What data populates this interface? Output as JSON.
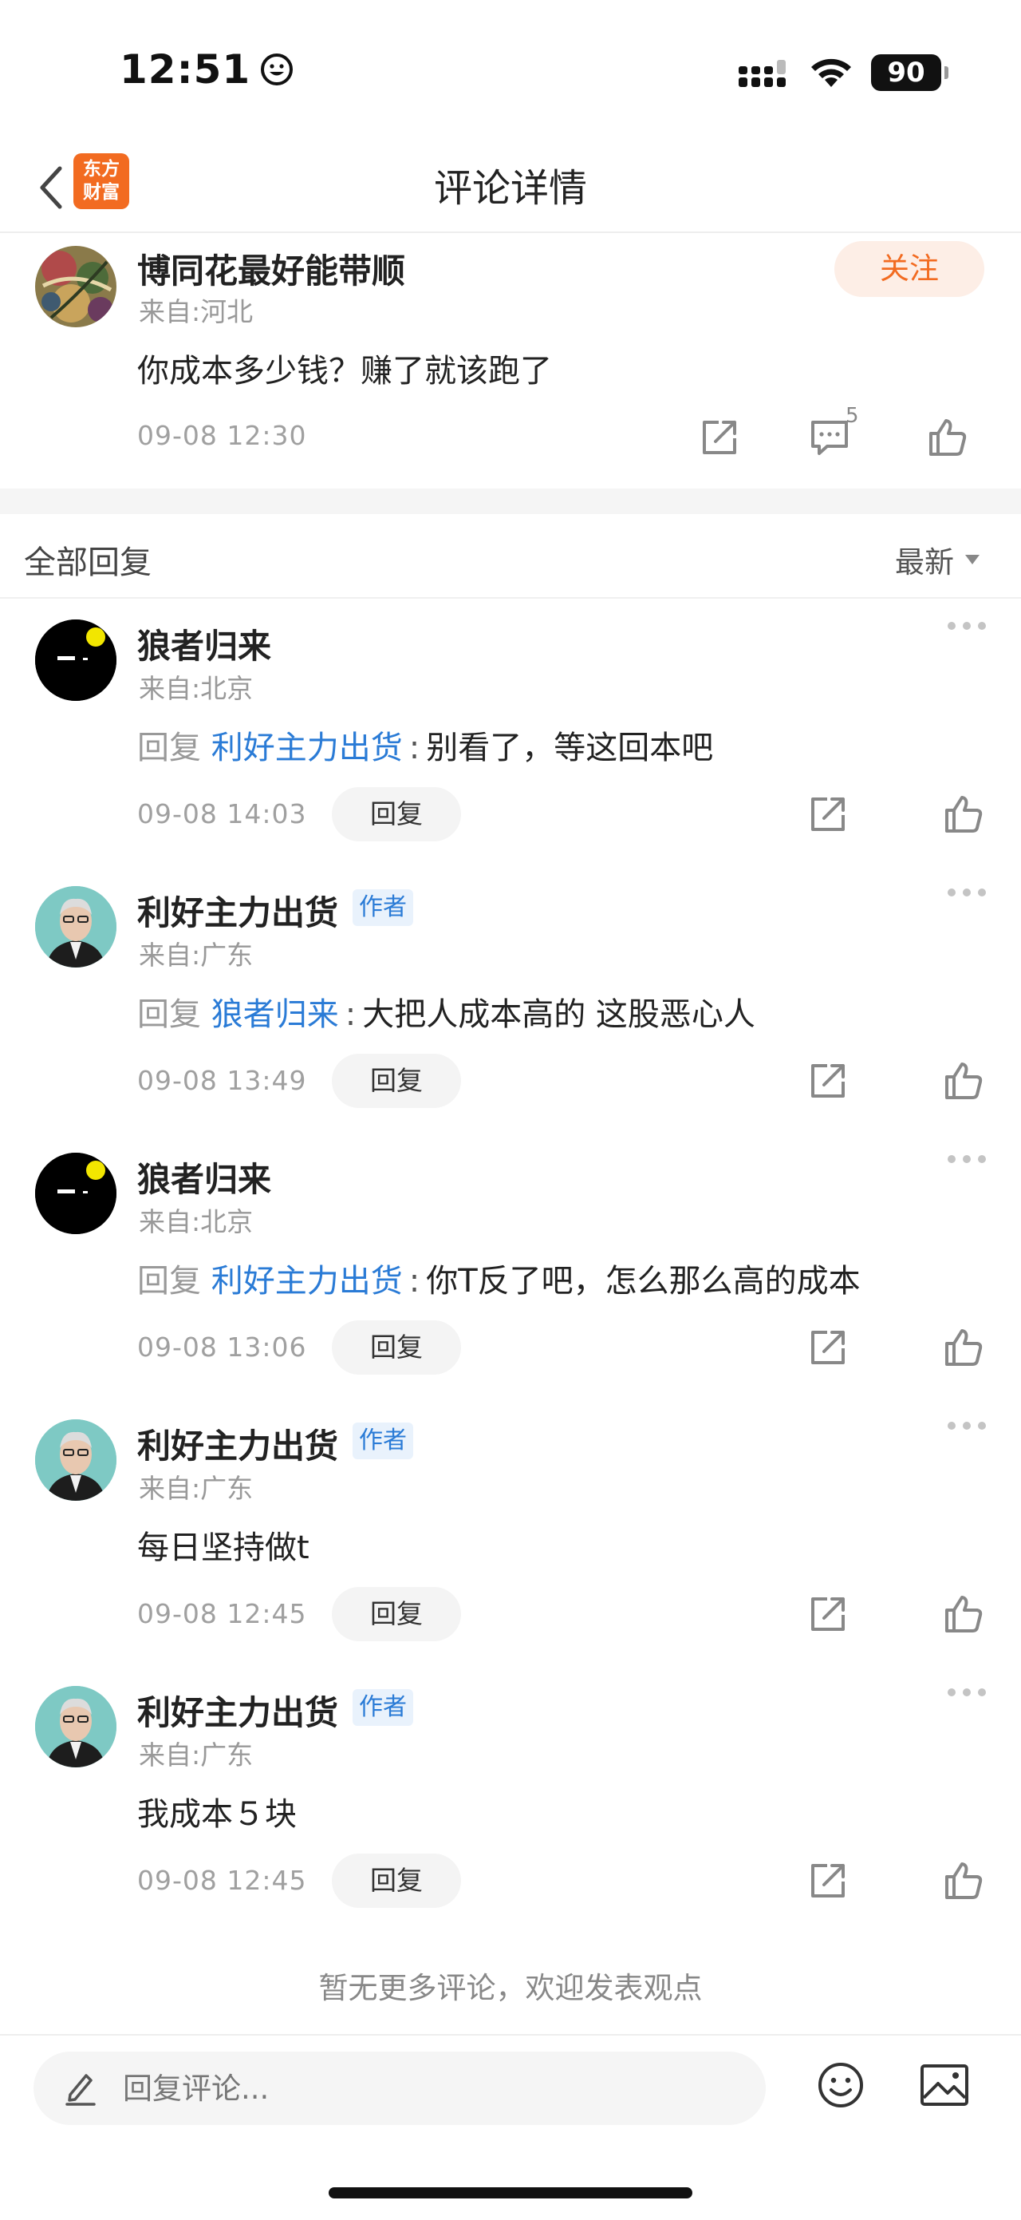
{
  "status_bar": {
    "time": "12:51",
    "battery": "90"
  },
  "nav": {
    "logo_line1": "东方",
    "logo_line2": "财富",
    "title": "评论详情"
  },
  "main_comment": {
    "username": "博同花最好能带顺",
    "location": "来自:河北",
    "text": "你成本多少钱？赚了就该跑了",
    "timestamp": "09-08 12:30",
    "follow_label": "关注",
    "comment_count": "5"
  },
  "replies_header": {
    "title": "全部回复",
    "sort": "最新"
  },
  "replies": [
    {
      "username": "狼者归来",
      "is_author": false,
      "location": "来自:北京",
      "reply_prefix": "回复",
      "reply_target": "利好主力出货",
      "colon": ":",
      "text": "别看了，等这回本吧",
      "timestamp": "09-08 14:03",
      "reply_label": "回复"
    },
    {
      "username": "利好主力出货",
      "is_author": true,
      "author_tag": "作者",
      "location": "来自:广东",
      "reply_prefix": "回复",
      "reply_target": "狼者归来",
      "colon": ":",
      "text": "大把人成本高的 这股恶心人",
      "timestamp": "09-08 13:49",
      "reply_label": "回复"
    },
    {
      "username": "狼者归来",
      "is_author": false,
      "location": "来自:北京",
      "reply_prefix": "回复",
      "reply_target": "利好主力出货",
      "colon": ":",
      "text": "你T反了吧，怎么那么高的成本",
      "timestamp": "09-08 13:06",
      "reply_label": "回复"
    },
    {
      "username": "利好主力出货",
      "is_author": true,
      "author_tag": "作者",
      "location": "来自:广东",
      "text": "每日坚持做t",
      "timestamp": "09-08 12:45",
      "reply_label": "回复"
    },
    {
      "username": "利好主力出货",
      "is_author": true,
      "author_tag": "作者",
      "location": "来自:广东",
      "text": "我成本５块",
      "timestamp": "09-08 12:45",
      "reply_label": "回复"
    }
  ],
  "footer": {
    "no_more": "暂无更多评论，欢迎发表观点"
  },
  "input": {
    "placeholder": "回复评论..."
  },
  "colors": {
    "brand_orange": "#f26b21",
    "link_blue": "#2a7bd6",
    "author_tag_bg": "#e9f2fc"
  }
}
